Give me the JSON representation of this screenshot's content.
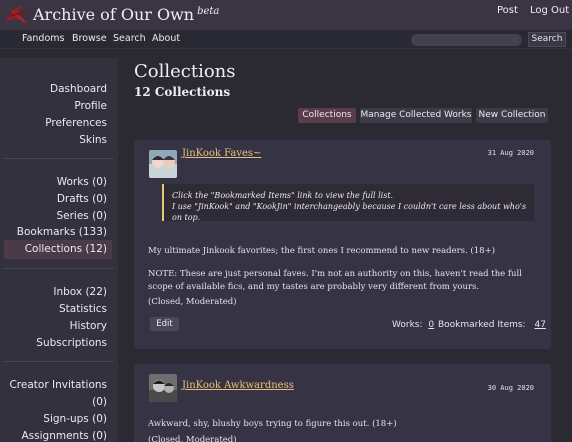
{
  "header": {
    "title": "Archive of Our Own",
    "badge": "beta",
    "post": "Post",
    "logout": "Log Out"
  },
  "nav": {
    "fandoms": "Fandoms",
    "browse": "Browse",
    "search": "Search",
    "about": "About",
    "search_input": "",
    "search_button": "Search"
  },
  "sidebar": {
    "group1": [
      "Dashboard",
      "Profile",
      "Preferences",
      "Skins"
    ],
    "group2": [
      "Works (0)",
      "Drafts (0)",
      "Series (0)",
      "Bookmarks (133)",
      "Collections (12)"
    ],
    "group3": [
      "Inbox (22)",
      "Statistics",
      "History",
      "Subscriptions"
    ],
    "group4": [
      "Creator Invitations",
      "(0)",
      "Sign-ups (0)",
      "Assignments (0)"
    ]
  },
  "main": {
    "title": "Collections",
    "subtitle": "12 Collections",
    "actions": [
      "Collections",
      "Manage Collected Works",
      "New Collection"
    ]
  },
  "collections": [
    {
      "title": "JinKook Faves~",
      "date": "31 Aug 2020",
      "quote_line1": "Click the \"Bookmarked Items\" link to view the full list.",
      "quote_line2": "I use \"JinKook\" and \"KookJin\" interchangeably because I couldn't care less about who's on top.",
      "p1": "My ultimate Jinkook favorites; the first ones I recommend to new readers. (18+)",
      "p2": "NOTE: These are just personal faves. I'm not an authority on this, haven't read the full scope of available fics, and my tastes are probably very different from yours.",
      "p3": "(Closed, Moderated)",
      "edit": "Edit",
      "works_label": "Works:",
      "works_value": "0",
      "bookmarked_label": "Bookmarked Items:",
      "bookmarked_value": "47"
    },
    {
      "title": "JinKook Awkwardness",
      "date": "30 Aug 2020",
      "p1": "Awkward, shy, blushy boys trying to figure this out. (18+)",
      "p2": "(Closed, Moderated)"
    }
  ],
  "colors": {
    "header_bg": "#3a3443",
    "page_bg": "#2b2a33",
    "accent_link": "#e9c27a",
    "active_tab": "#5a3d4a",
    "logo_red": "#9b1d24"
  }
}
